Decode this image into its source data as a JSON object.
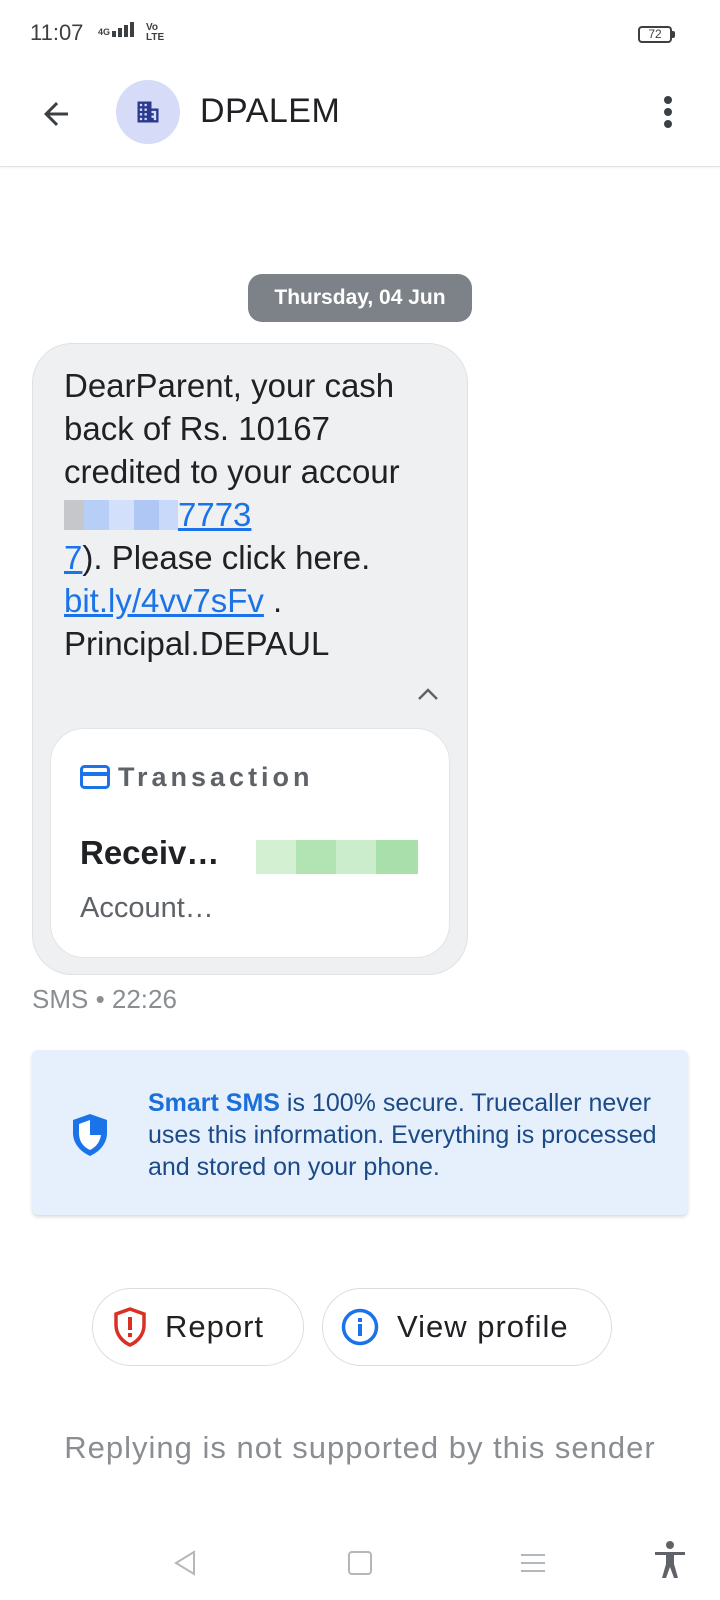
{
  "status_bar": {
    "time": "11:07",
    "network": "4G",
    "volte": "Vo\nLTE",
    "battery": "72"
  },
  "header": {
    "title": "DPALEM",
    "back_icon": "arrow-back-icon",
    "avatar_icon": "building-icon",
    "menu_icon": "more-vert-icon"
  },
  "conversation": {
    "date_chip": "Thursday, 04 Jun",
    "message": {
      "line1": "DearParent, your cash back of Rs. 10167 credited to your accour",
      "link_account_tail": "7773",
      "link_account_end": "7",
      "after_account": "). Please click here. ",
      "link_url": "bit.ly/4vv7sFv",
      "after_url": " . Principal.DEPAUL"
    },
    "transaction": {
      "title": "Transaction",
      "received_label": "Receiv…",
      "account_label": "Account…"
    },
    "meta": "SMS • 22:26"
  },
  "info_card": {
    "strong": "Smart SMS",
    "text": " is 100% secure. Truecaller never uses this information. Everything is processed and stored on your phone."
  },
  "actions": {
    "report": "Report",
    "view_profile": "View profile"
  },
  "reply_note": "Replying is not supported by this sender",
  "colors": {
    "accent": "#1a73e8",
    "report_red": "#d93025",
    "info_bg": "#e6f0fd",
    "bubble_bg": "#eef0f1"
  }
}
